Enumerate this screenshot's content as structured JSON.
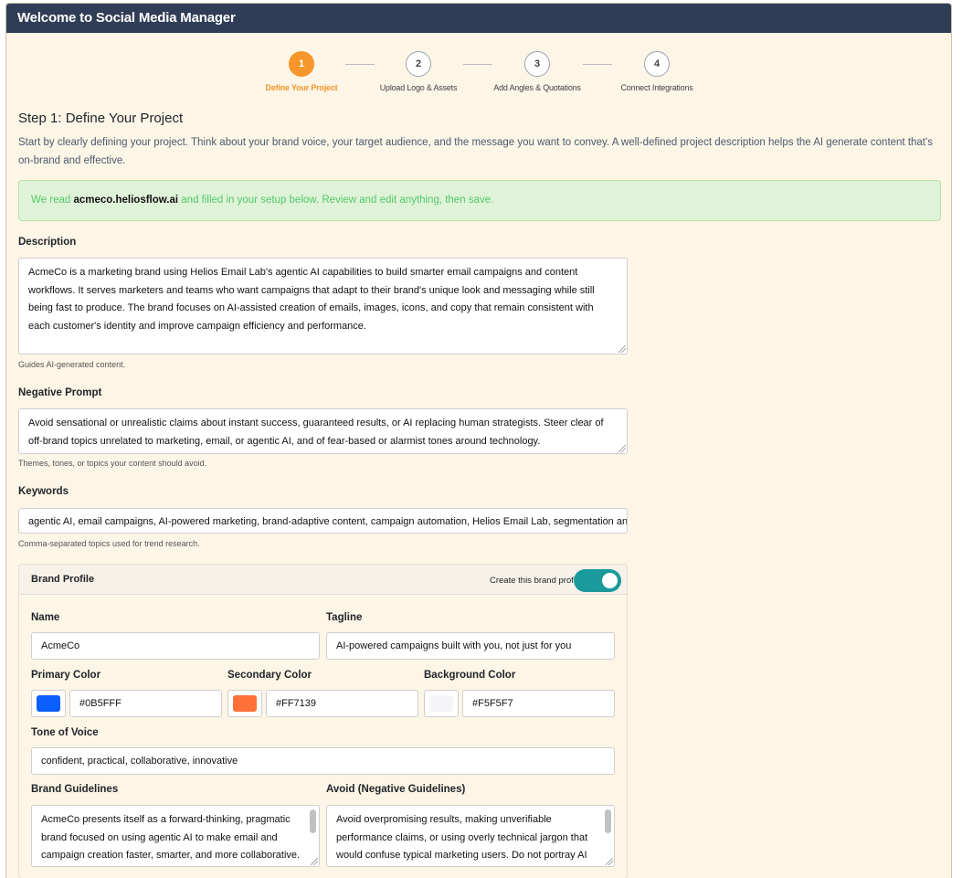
{
  "window": {
    "title": "Welcome to Social Media Manager"
  },
  "stepper": {
    "steps": [
      {
        "number": "1",
        "label": "Define Your Project",
        "active": true
      },
      {
        "number": "2",
        "label": "Upload Logo & Assets",
        "active": false
      },
      {
        "number": "3",
        "label": "Add Angles & Quotations",
        "active": false
      },
      {
        "number": "4",
        "label": "Connect Integrations",
        "active": false
      }
    ]
  },
  "main": {
    "title": "Step 1: Define Your Project",
    "intro": "Start by clearly defining your project. Think about your brand voice, your target audience, and the message you want to convey. A well-defined project description helps the AI generate content that's on-brand and effective.",
    "alert": {
      "prefix": "We read ",
      "domain": "acmeco.heliosflow.ai",
      "suffix": " and filled in your setup below. Review and edit anything, then save."
    }
  },
  "description": {
    "label": "Description",
    "value": "AcmeCo is a marketing brand using Helios Email Lab's agentic AI capabilities to build smarter email campaigns and content workflows. It serves marketers and teams who want campaigns that adapt to their brand's unique look and messaging while still being fast to produce. The brand focuses on AI-assisted creation of emails, images, icons, and copy that remain consistent with each customer's identity and improve campaign efficiency and performance.",
    "help": "Guides AI-generated content."
  },
  "negative_prompt": {
    "label": "Negative Prompt",
    "value": "Avoid sensational or unrealistic claims about instant success, guaranteed results, or AI replacing human strategists. Steer clear of off-brand topics unrelated to marketing, email, or agentic AI, and of fear-based or alarmist tones around technology.",
    "help": "Themes, tones, or topics your content should avoid."
  },
  "keywords": {
    "label": "Keywords",
    "value": "agentic AI, email campaigns, AI-powered marketing, brand-adaptive content, campaign automation, Helios Email Lab, segmentation and t",
    "help": "Comma-separated topics used for trend research."
  },
  "brand_profile": {
    "title": "Brand Profile",
    "toggle_label": "Create this brand profile",
    "toggle_on": true,
    "name": {
      "label": "Name",
      "value": "AcmeCo"
    },
    "tagline": {
      "label": "Tagline",
      "value": "AI-powered campaigns built with you, not just for you"
    },
    "primary_color": {
      "label": "Primary Color",
      "value": "#0B5FFF"
    },
    "secondary_color": {
      "label": "Secondary Color",
      "value": "#FF7139"
    },
    "background_color": {
      "label": "Background Color",
      "value": "#F5F5F7"
    },
    "tone": {
      "label": "Tone of Voice",
      "value": "confident, practical, collaborative, innovative"
    },
    "guidelines": {
      "label": "Brand Guidelines",
      "value": "AcmeCo presents itself as a forward-thinking, pragmatic brand focused on using agentic AI to make email and campaign creation faster, smarter, and more collaborative. The brand should sound knowledgeable and efficient while still approachable."
    },
    "avoid": {
      "label": "Avoid (Negative Guidelines)",
      "value": "Avoid overpromising results, making unverifiable performance claims, or using overly technical jargon that would confuse typical marketing users. Do not portray AI as a replacement for human creativity or judgment."
    }
  },
  "colors": {
    "accent": "#f7962a",
    "titlebar": "#2f3e56",
    "toggle": "#1a9a9a",
    "background": "#fdf5e6"
  }
}
